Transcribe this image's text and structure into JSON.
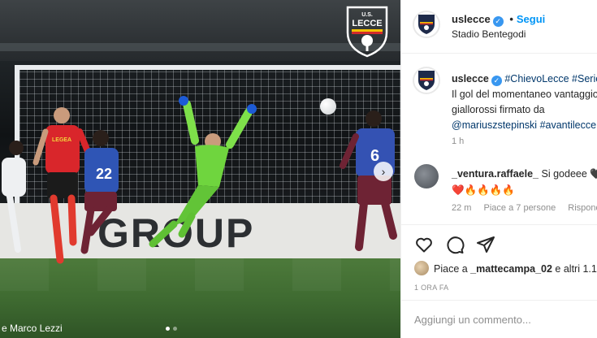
{
  "post": {
    "username": "uslecce",
    "follow_label": "Segui",
    "separator": "•",
    "location": "Stadio Bentegodi",
    "verified_icon": "verified-badge-icon",
    "accent_color": "#0095f6"
  },
  "photo": {
    "logo_top": "U.S.",
    "logo_name": "LECCE",
    "ad_text": "GROUP",
    "jersey_number_keeper": "22",
    "jersey_number_right": "6",
    "referee_sponsor": "LEGEA",
    "credit": "e Marco Lezzi",
    "slides": 2,
    "active_slide": 1
  },
  "caption": {
    "username": "uslecce",
    "tags_line": "#ChievoLecce #SerieB",
    "line2": "Il gol del momentaneo vantaggio",
    "line3": "giallorossi firmato da",
    "mention": "@mariuszstepinski",
    "hashtag": "#avantilecce",
    "time": "1 h"
  },
  "comment": {
    "username": "_ventura.raffaele_",
    "text": "Si godeee 🖤",
    "emojis": "❤️🔥🔥🔥🔥",
    "time": "22 m",
    "likes": "Piace a 7 persone",
    "reply": "Rispondi"
  },
  "actions": {
    "liked_by": "Piace a ",
    "liked_user": "_mattecampa_02",
    "liked_rest": " e altri 1.1",
    "post_time": "1 ORA FA",
    "comment_placeholder": "Aggiungi un commento..."
  }
}
